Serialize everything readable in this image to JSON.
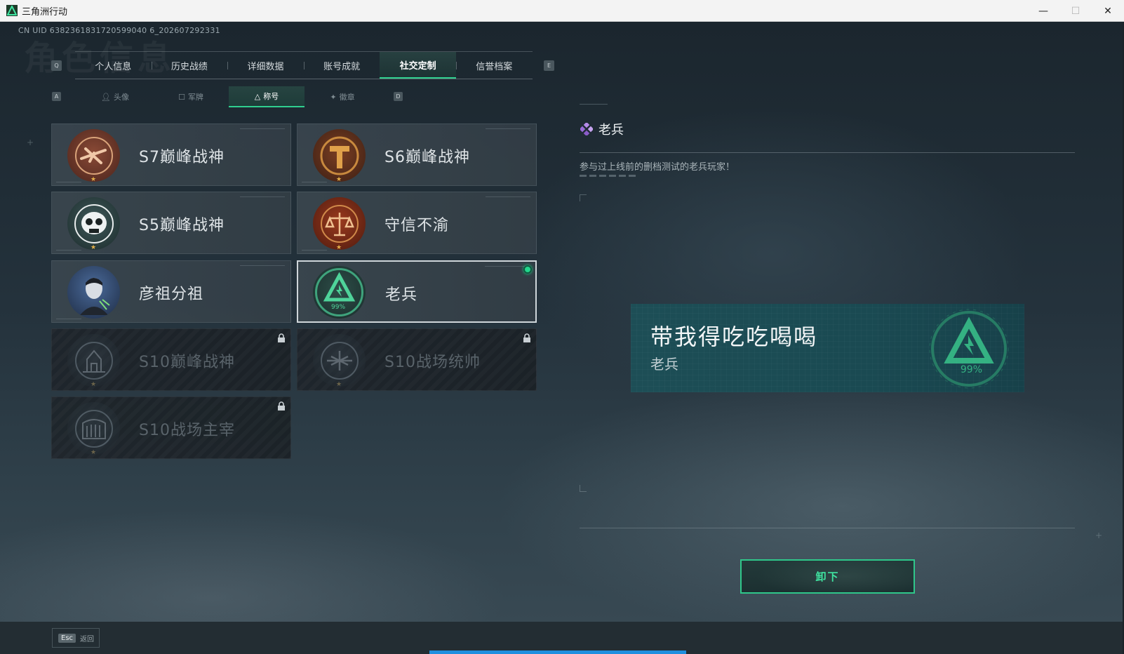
{
  "window": {
    "title": "三角洲行动",
    "controls": {
      "minimize": "—",
      "maximize": "☐",
      "close": "✕"
    }
  },
  "uid_text": "CN UID 6382361831720599040 6_202607292331",
  "watermark": "角色信息",
  "main_tabs": {
    "prev_key": "Q",
    "next_key": "E",
    "items": [
      {
        "label": "个人信息",
        "active": false
      },
      {
        "label": "历史战绩",
        "active": false
      },
      {
        "label": "详细数据",
        "active": false
      },
      {
        "label": "账号成就",
        "active": false
      },
      {
        "label": "社交定制",
        "active": true
      },
      {
        "label": "信誉档案",
        "active": false
      }
    ]
  },
  "sub_tabs": {
    "prev_key": "A",
    "next_key": "D",
    "items": [
      {
        "label": "头像",
        "icon": "user-icon",
        "active": false
      },
      {
        "label": "军牌",
        "icon": "dogtag-icon",
        "active": false
      },
      {
        "label": "称号",
        "icon": "title-icon",
        "active": true
      },
      {
        "label": "徽章",
        "icon": "badge-icon",
        "active": false
      }
    ]
  },
  "titles": [
    {
      "label": "S7巅峰战神",
      "state": "unlocked",
      "badge": "s7-crossbow-badge"
    },
    {
      "label": "S6巅峰战神",
      "state": "unlocked",
      "badge": "s6-t-badge"
    },
    {
      "label": "S5巅峰战神",
      "state": "unlocked",
      "badge": "s5-skull-badge"
    },
    {
      "label": "守信不渝",
      "state": "unlocked",
      "badge": "scales-badge"
    },
    {
      "label": "彦祖分祖",
      "state": "unlocked",
      "badge": "portrait-badge"
    },
    {
      "label": "老兵",
      "state": "equipped",
      "badge": "veteran-triangle-badge",
      "badge_text": "99%"
    },
    {
      "label": "S10巅峰战神",
      "state": "locked",
      "badge": "s10-monument-badge"
    },
    {
      "label": "S10战场统帅",
      "state": "locked",
      "badge": "s10-aircraft-badge"
    },
    {
      "label": "S10战场主宰",
      "state": "locked",
      "badge": "s10-colosseum-badge"
    }
  ],
  "detail": {
    "title": "老兵",
    "description": "参与过上线前的删档测试的老兵玩家！",
    "preview_name": "带我得吃吃喝喝",
    "preview_title": "老兵",
    "preview_badge_text": "99%",
    "unequip_label": "卸下"
  },
  "footer": {
    "esc_key": "Esc",
    "esc_label": "返回"
  },
  "colors": {
    "accent": "#2fd08f",
    "gold": "#e3b04a",
    "panel_teal": "#1d4e56"
  }
}
